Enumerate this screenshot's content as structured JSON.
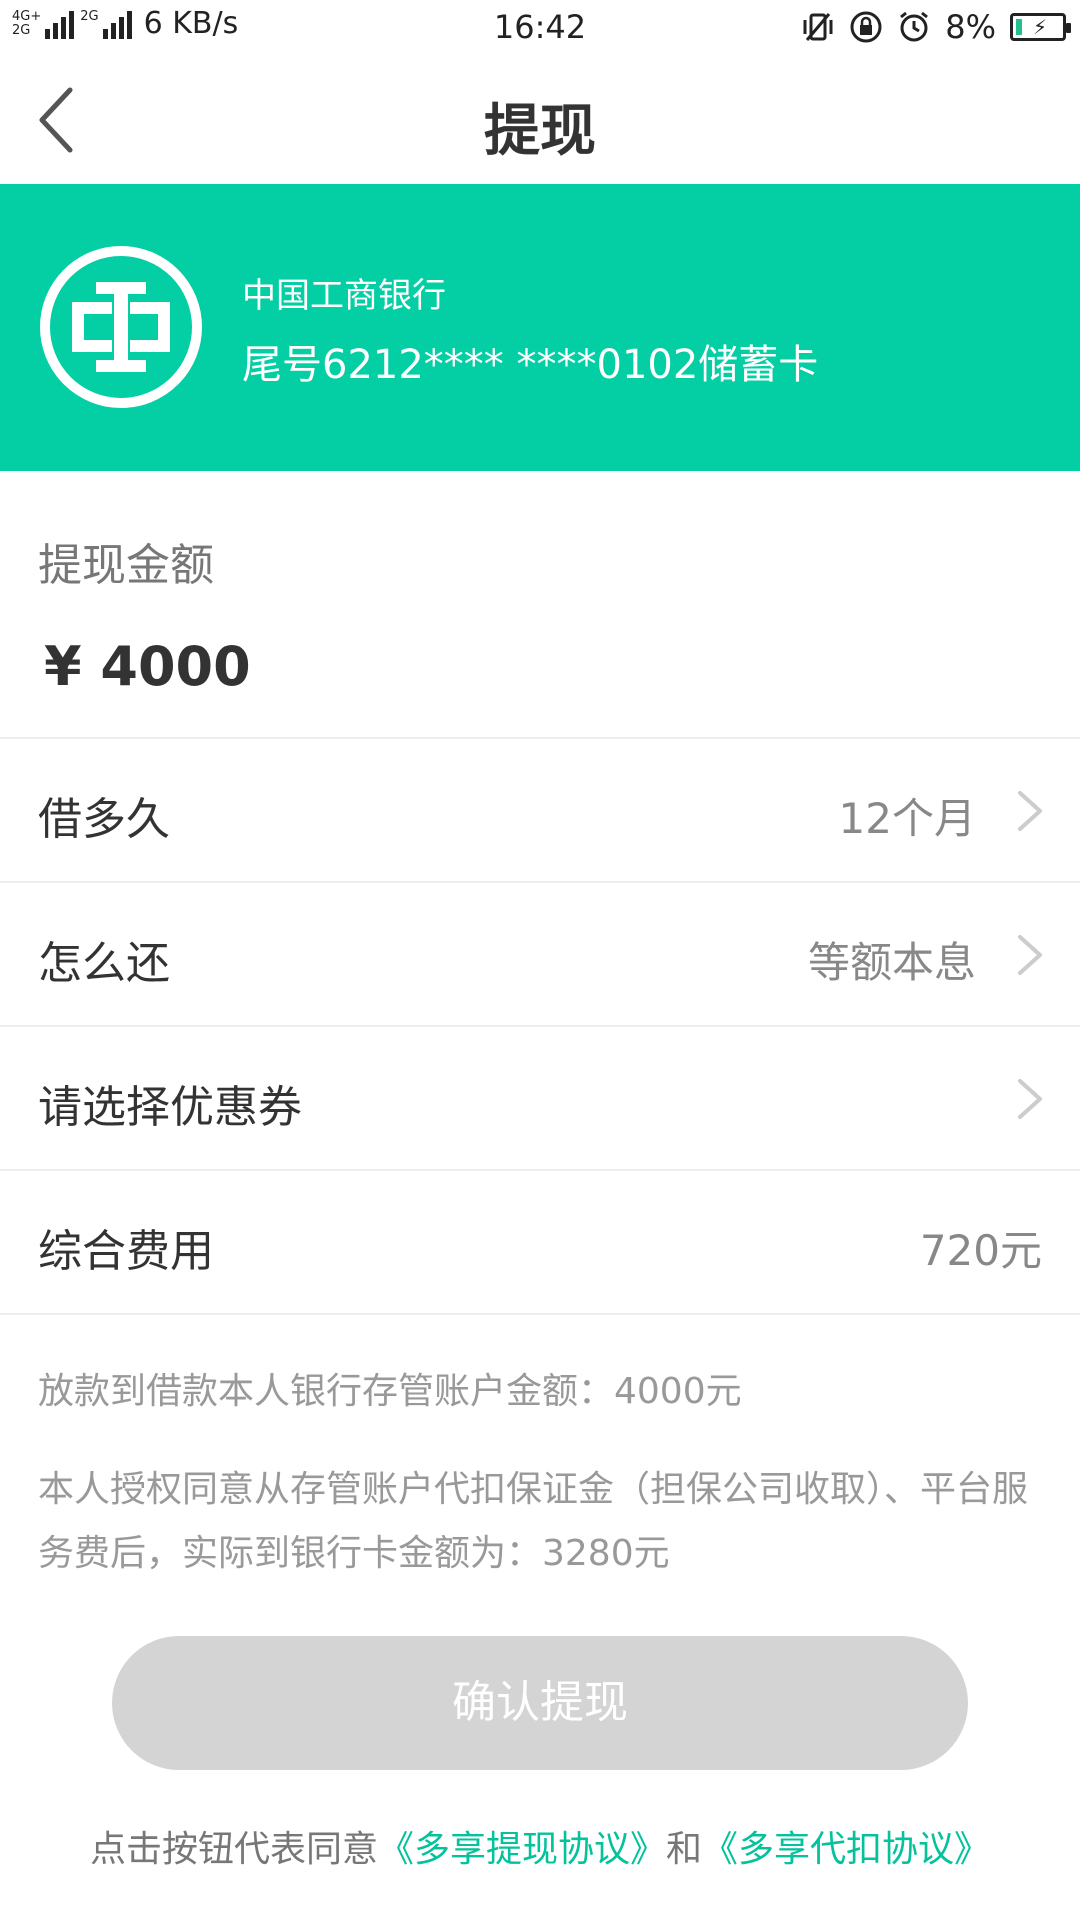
{
  "status_bar": {
    "network_left": "4G+",
    "network_left2": "2G",
    "network_right": "2G",
    "speed": "6 KB/s",
    "time": "16:42",
    "battery_percent": "8%",
    "icons": [
      "vibrate-icon",
      "rotation-lock-icon",
      "alarm-icon",
      "battery-charging-icon"
    ]
  },
  "nav": {
    "title": "提现",
    "back_icon": "chevron-left-icon"
  },
  "bank_card": {
    "bank_name": "中国工商银行",
    "card_number": "尾号6212**** ****0102储蓄卡",
    "logo": "icbc-logo",
    "background_color": "#03cea4"
  },
  "amount": {
    "label": "提现金额",
    "value": "¥ 4000"
  },
  "rows": {
    "loan_term": {
      "label": "借多久",
      "value": "12个月"
    },
    "repayment": {
      "label": "怎么还",
      "value": "等额本息"
    },
    "coupon": {
      "label": "请选择优惠券",
      "value": ""
    },
    "fee": {
      "label": "综合费用",
      "value": "720元"
    }
  },
  "notes": {
    "line1": "放款到借款本人银行存管账户金额：4000元",
    "line2": "本人授权同意从存管账户代扣保证金（担保公司收取）、平台服务费后，实际到银行卡金额为：3280元"
  },
  "confirm_button": {
    "label": "确认提现",
    "state": "disabled"
  },
  "agreement": {
    "prefix": "点击按钮代表同意",
    "link1": "《多享提现协议》",
    "conjunction": "和",
    "link2": "《多享代扣协议》",
    "link_color": "#03c29c"
  }
}
